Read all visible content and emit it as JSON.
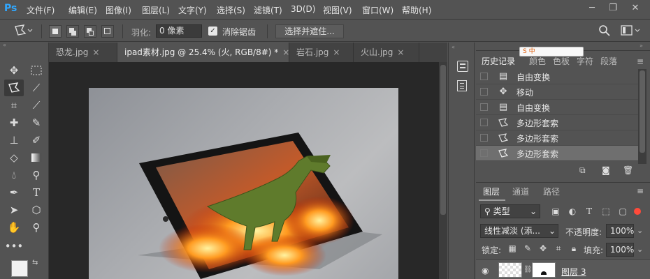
{
  "app": {
    "logo": "Ps"
  },
  "menu": [
    "文件(F)",
    "编辑(E)",
    "图像(I)",
    "图层(L)",
    "文字(Y)",
    "选择(S)",
    "滤镜(T)",
    "3D(D)",
    "视图(V)",
    "窗口(W)",
    "帮助(H)"
  ],
  "options": {
    "feather_label": "羽化:",
    "feather_value": "0 像素",
    "antialias_label": "消除锯齿",
    "select_mask_button": "选择并遮住..."
  },
  "tabs": [
    {
      "label": "恐龙.jpg",
      "close": "×"
    },
    {
      "label": "ipad素材.jpg @ 25.4% (火, RGB/8#) *",
      "close": "×"
    },
    {
      "label": "岩石.jpg",
      "close": "×"
    },
    {
      "label": "火山.jpg",
      "close": "×"
    }
  ],
  "history": {
    "tabs": [
      "历史记录",
      "颜色",
      "色板",
      "字符",
      "段落"
    ],
    "items": [
      {
        "label": "自由变换",
        "icon": "transform-icon"
      },
      {
        "label": "移动",
        "icon": "move-icon"
      },
      {
        "label": "自由变换",
        "icon": "transform-icon"
      },
      {
        "label": "多边形套索",
        "icon": "polygon-lasso-icon"
      },
      {
        "label": "多边形套索",
        "icon": "polygon-lasso-icon"
      },
      {
        "label": "多边形套索",
        "icon": "polygon-lasso-icon"
      }
    ]
  },
  "layers": {
    "tabs": [
      "图层",
      "通道",
      "路径"
    ],
    "filter_label": "类型",
    "blend_mode": "线性减淡 (添...",
    "opacity_label": "不透明度:",
    "opacity_value": "100%",
    "lock_label": "锁定:",
    "fill_label": "填充:",
    "fill_value": "100%",
    "layer_name": "图层 3"
  },
  "ime_badge": "S 中"
}
